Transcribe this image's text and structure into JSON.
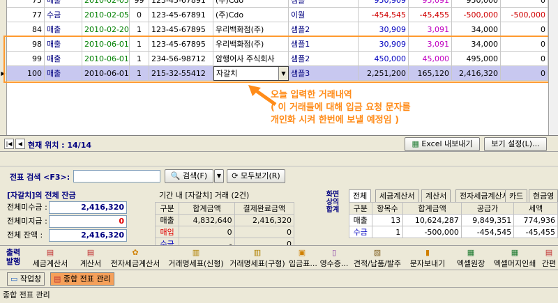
{
  "grid": {
    "rows": [
      {
        "id": "75",
        "type": "매출",
        "date": "2010-02-05",
        "cnt": "99",
        "biz": "123-45-67891",
        "name": "(주)Cdo",
        "item": "샘플",
        "supply": "950,909",
        "tax": "95,091",
        "total": "950,000",
        "balance": "0"
      },
      {
        "id": "77",
        "type": "수금",
        "date": "2010-02-05",
        "cnt": "0",
        "biz": "123-45-67891",
        "name": "(주)Cdo",
        "item": "이월",
        "supply": "-454,545",
        "tax": "-45,455",
        "total": "-500,000",
        "balance": "-500,000"
      },
      {
        "id": "",
        "type": "",
        "date": "",
        "cnt": "",
        "biz": "",
        "name": "",
        "item": "",
        "supply": "",
        "tax": "",
        "total": "",
        "balance": ""
      },
      {
        "id": "84",
        "type": "매출",
        "date": "2010-02-20",
        "cnt": "1",
        "biz": "123-45-67895",
        "name": "우리백화점(주)",
        "item": "샘플2",
        "supply": "30,909",
        "tax": "3,091",
        "total": "34,000",
        "balance": "0"
      },
      {
        "id": "",
        "type": "",
        "date": "",
        "cnt": "",
        "biz": "",
        "name": "",
        "item": "",
        "supply": "",
        "tax": "",
        "total": "",
        "balance": ""
      },
      {
        "id": "98",
        "type": "매출",
        "date": "2010-06-01",
        "cnt": "1",
        "biz": "123-45-67895",
        "name": "우리백화점(주)",
        "item": "샘플1",
        "supply": "30,909",
        "tax": "3,091",
        "total": "34,000",
        "balance": "0"
      },
      {
        "id": "99",
        "type": "매출",
        "date": "2010-06-01",
        "cnt": "1",
        "biz": "234-56-98712",
        "name": "암행어사 주식회사",
        "item": "샘플2",
        "supply": "450,000",
        "tax": "45,000",
        "total": "495,000",
        "balance": "0"
      },
      {
        "id": "100",
        "type": "매출",
        "date": "2010-06-01",
        "cnt": "1",
        "biz": "215-32-55412",
        "name": "자갈치",
        "item": "샘플3",
        "supply": "2,251,200",
        "tax": "165,120",
        "total": "2,416,320",
        "balance": "0"
      }
    ]
  },
  "annotation": {
    "line1": "오늘 입력한 거래내역",
    "line2": "( 이 거래들에 대해 입금 요청 문자를",
    "line3": "개인화 시켜 한번에 보낼 예정임 )"
  },
  "nav": {
    "position_label": "현재 위치 : 14/14",
    "excel_label": "Excel 내보내기",
    "view_settings_label": "보기 설정(L)..."
  },
  "search": {
    "label": "전표 검색 <F3>:",
    "search_button": "검색(F)",
    "show_all_button": "모두보기(R)"
  },
  "balance": {
    "title": "[자갈치]의 전체 잔금",
    "total_receivable_label": "전체미수금 :",
    "total_receivable": "2,416,320",
    "total_payable_label": "전체미지급 :",
    "total_payable": "0",
    "total_balance_label": "전체 잔액 :",
    "total_balance": "2,416,320"
  },
  "period": {
    "title": "기간 내 [자갈치] 거래 (2건)",
    "headers": [
      "구분",
      "합계금액",
      "결제완료금액"
    ],
    "rows": [
      {
        "label": "매출",
        "total": "4,832,640",
        "paid": "2,416,320"
      },
      {
        "label": "매입",
        "total": "0",
        "paid": "0"
      },
      {
        "label": "수금",
        "total": "-",
        "paid": "0"
      }
    ]
  },
  "screen_total": {
    "label1": "화면",
    "label2": "상의",
    "label3": "합계",
    "tabs": [
      "전체",
      "세금계산서",
      "계산서",
      "전자세금계산서",
      "카드",
      "현금영"
    ],
    "headers": [
      "구분",
      "항목수",
      "합계금액",
      "공급가",
      "세액"
    ],
    "rows": [
      {
        "label": "매출",
        "count": "13",
        "total": "10,624,287",
        "supply": "9,849,351",
        "tax": "774,936"
      },
      {
        "label": "수금",
        "count": "1",
        "total": "-500,000",
        "supply": "-454,545",
        "tax": "-45,455"
      }
    ]
  },
  "toolbar": {
    "print_label1": "출력",
    "print_label2": "발행",
    "items": [
      "세금계산서",
      "계산서",
      "전자세금계산서",
      "거래명세표(신형)",
      "거래명세표(구형)",
      "입금표...",
      "영수증...",
      "견적/납품/발주",
      "문자보내기",
      "엑셀원장",
      "엑셀머지인쇄",
      "간편"
    ]
  },
  "taskbar": {
    "workspace": "작업창",
    "active": "종합 전표 관리"
  },
  "status": "종합 전표 관리",
  "colors": {
    "accent": "#ff9a2e",
    "header_text": "#000080",
    "selected_row": "#c8c8f0"
  }
}
